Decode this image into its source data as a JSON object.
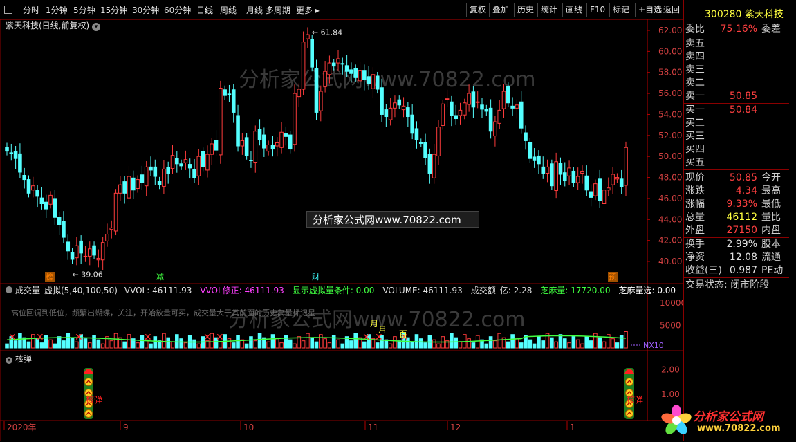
{
  "toolbar": {
    "periods": [
      "分时",
      "1分钟",
      "5分钟",
      "15分钟",
      "30分钟",
      "60分钟",
      "日线",
      "周线",
      "月线",
      "多周期",
      "更多"
    ],
    "selected": "日线",
    "right_buttons": [
      "复权",
      "叠加",
      "历史",
      "统计",
      "画线",
      "F10",
      "标记",
      "+自选",
      "返回"
    ]
  },
  "stock": {
    "code": "300280",
    "name": "紫天科技"
  },
  "main_chart": {
    "title": "紫天科技(日线,前复权)",
    "high_label": "61.84",
    "low_label": "39.06",
    "yticks": [
      "62.00",
      "60.00",
      "58.00",
      "56.00",
      "54.00",
      "52.00",
      "50.00",
      "48.00",
      "46.00",
      "44.00",
      "42.00",
      "40.00"
    ],
    "markers": [
      "榜",
      "减",
      "财",
      "预"
    ],
    "watermark": "分析家公式网www.70822.com",
    "banner": "分析家公式网www.70822.com"
  },
  "volume_panel": {
    "title": "成交量_虚拟(5,40,100,50)",
    "items": [
      {
        "label": "VVOL: 46111.93",
        "color": "#e0e0e0"
      },
      {
        "label": "VVOL修正: 46111.93",
        "color": "#ff40ff"
      },
      {
        "label": "显示虚拟量条件: 0.00",
        "color": "#40ff40"
      },
      {
        "label": "VOLUME: 46111.93",
        "color": "#e0e0e0"
      },
      {
        "label": "成交额_亿: 2.28",
        "color": "#e0e0e0"
      },
      {
        "label": "芝麻量: 17720.00",
        "color": "#40ff40"
      },
      {
        "label": "芝麻量选: 0.00",
        "color": "#ffffff"
      }
    ],
    "hint": "高位回调到低位，频繁出蝴蝶，关注，开始放量可买，成交量大于其前面的历史高量标记星",
    "yticks": [
      "10000",
      "5000"
    ],
    "nx_label": "NX10",
    "yue_labels": [
      "月",
      "月",
      "百"
    ]
  },
  "hedan_panel": {
    "title": "核弹",
    "yticks": [
      "2.00",
      "1.00"
    ],
    "labels": [
      "核弹",
      "核弹"
    ]
  },
  "x_axis": [
    "2020年",
    "9",
    "10",
    "11",
    "12",
    "1"
  ],
  "quote": {
    "weibi": {
      "label": "委比",
      "value": "75.16%",
      "suffix": "委差"
    },
    "sells": [
      "卖五",
      "卖四",
      "卖三",
      "卖二",
      "卖一"
    ],
    "sell1_price": "50.85",
    "buys": [
      "买一",
      "买二",
      "买三",
      "买四",
      "买五"
    ],
    "buy1_price": "50.84",
    "rows": [
      {
        "label": "现价",
        "value": "50.85",
        "suffix": "今开",
        "color": "#ff4040"
      },
      {
        "label": "涨跌",
        "value": "4.34",
        "suffix": "最高",
        "color": "#ff4040"
      },
      {
        "label": "涨幅",
        "value": "9.33%",
        "suffix": "最低",
        "color": "#ff4040"
      },
      {
        "label": "总量",
        "value": "46112",
        "suffix": "量比",
        "color": "#ffff40"
      },
      {
        "label": "外盘",
        "value": "27150",
        "suffix": "内盘",
        "color": "#ff4040"
      }
    ],
    "rows2": [
      {
        "label": "换手",
        "value": "2.99%",
        "suffix": "股本",
        "color": "#e0e0e0"
      },
      {
        "label": "净资",
        "value": "12.08",
        "suffix": "流通",
        "color": "#e0e0e0"
      },
      {
        "label": "收益(三)",
        "value": "0.987",
        "suffix": "PE动",
        "color": "#e0e0e0"
      }
    ],
    "status": "交易状态: 闭市阶段"
  },
  "logo": {
    "text": "分析家公式网",
    "url": "www.70822.com"
  },
  "colors": {
    "up": "#ff3c3c",
    "down": "#54ffff",
    "axis": "#b40000",
    "ma": "#40ff40"
  }
}
